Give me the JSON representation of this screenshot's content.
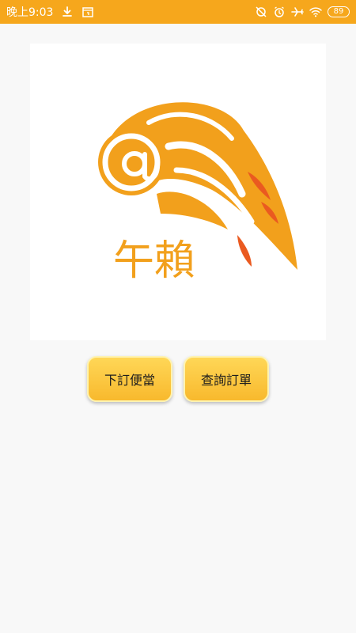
{
  "status_bar": {
    "time": "晚上9:03",
    "battery": "89",
    "background_color": "#f6a71c",
    "left_icons": [
      "download-icon",
      "calendar-icon"
    ],
    "right_icons": [
      "sync-off-icon",
      "alarm-icon",
      "airplane-icon",
      "wifi-icon"
    ]
  },
  "logo": {
    "text": "午賴",
    "primary_color": "#f2a01c",
    "accent_color": "#ea5a20"
  },
  "actions": {
    "order_label": "下訂便當",
    "query_label": "查詢訂單"
  },
  "colors": {
    "page_background": "#f8f8f8",
    "button_gradient_top": "#ffd757",
    "button_gradient_bottom": "#f8b92d"
  }
}
